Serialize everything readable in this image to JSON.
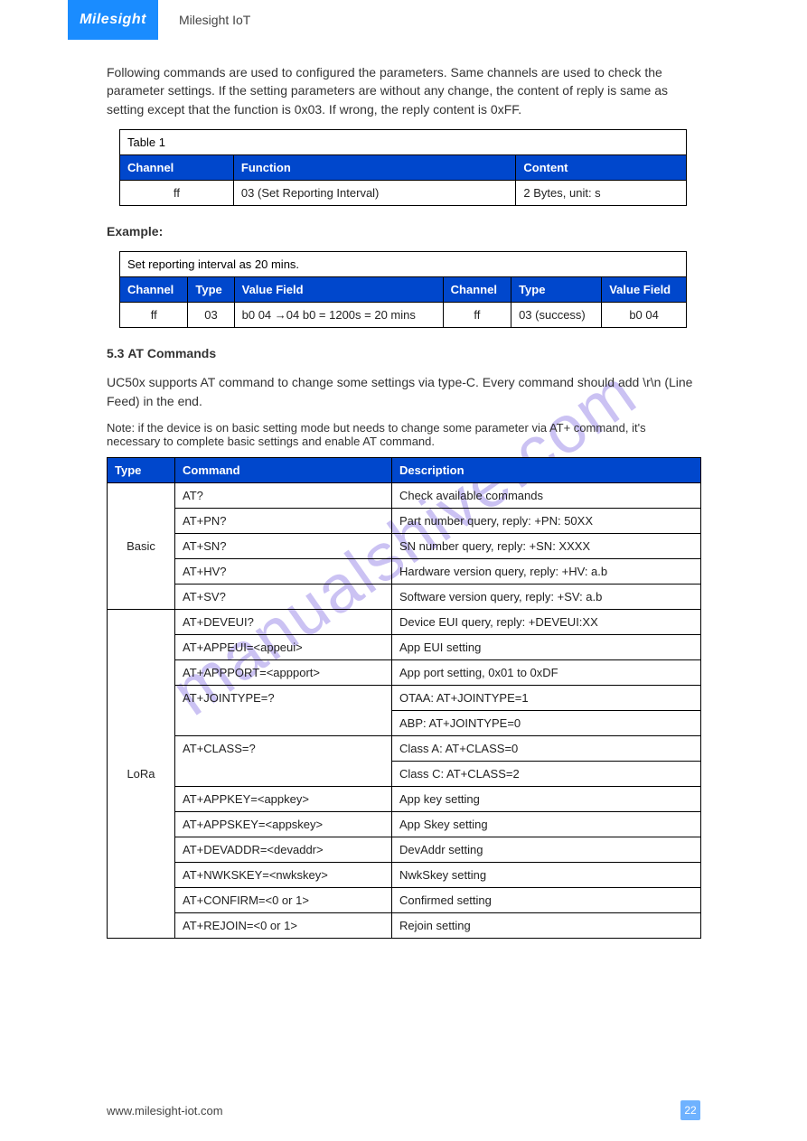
{
  "header": {
    "logo_text": "Milesight",
    "brand_sub": "Milesight IoT"
  },
  "watermark": "manualshive.com",
  "intro_para": "Following commands are used to configured the parameters. Same channels are used to check the parameter settings. If the setting parameters are without any change, the content of reply is same as setting except that the function is 0x03. If wrong, the reply content is 0xFF.",
  "table1": {
    "caption": "Table 1",
    "headers": [
      "Channel",
      "Function",
      "Content"
    ],
    "rows": [
      [
        "ff",
        "03 (Set Reporting Interval)",
        "2 Bytes, unit: s"
      ]
    ]
  },
  "example_heading": "Example:",
  "table2": {
    "caption": "Set reporting interval as 20 mins.",
    "headers": [
      "Channel",
      "Type",
      "Value Field",
      "Channel",
      "Type",
      "Value Field"
    ],
    "rows": [
      [
        "ff",
        "03",
        "b0 04 →04 b0 = 1200s = 20 mins",
        "ff",
        "03 (success)",
        "b0 04"
      ]
    ]
  },
  "section": {
    "number": "5.3",
    "title": "AT Commands"
  },
  "at_para": "UC50x supports AT command to change some settings via type-C. Every command should add \\r\\n (Line Feed) in the end.",
  "note": "Note: if the device is on basic setting mode but needs to change some parameter via AT+ command, it's necessary to complete basic settings and enable AT command.",
  "table3": {
    "headers": [
      "Type",
      "Command",
      "Description"
    ],
    "groups": [
      {
        "type": "Basic",
        "rows": [
          [
            "AT?",
            "Check available commands"
          ],
          [
            "AT+PN?",
            "Part number query, reply: +PN: 50XX"
          ],
          [
            "AT+SN?",
            "SN number query, reply: +SN: XXXX"
          ],
          [
            "AT+HV?",
            "Hardware version query, reply: +HV: a.b"
          ],
          [
            "AT+SV?",
            "Software version query, reply: +SV: a.b"
          ]
        ]
      },
      {
        "type": "LoRa",
        "rows": [
          [
            "AT+DEVEUI?",
            "Device EUI query, reply: +DEVEUI:XX"
          ],
          [
            "AT+APPEUI=<appeui>",
            "App EUI setting"
          ],
          [
            "AT+APPPORT=<appport>",
            "App port setting, 0x01 to 0xDF"
          ],
          [
            "AT+JOINTYPE=?",
            "OTAA: AT+JOINTYPE=1"
          ],
          [
            "",
            "ABP: AT+JOINTYPE=0"
          ],
          [
            "AT+CLASS=?",
            "Class A: AT+CLASS=0"
          ],
          [
            "",
            "Class C: AT+CLASS=2"
          ],
          [
            "AT+APPKEY=<appkey>",
            "App key setting"
          ],
          [
            "AT+APPSKEY=<appskey>",
            "App Skey setting"
          ],
          [
            "AT+DEVADDR=<devaddr>",
            "DevAddr setting"
          ],
          [
            "AT+NWKSKEY=<nwkskey>",
            "NwkSkey setting"
          ],
          [
            "AT+CONFIRM=<0 or 1>",
            "Confirmed setting"
          ],
          [
            "AT+REJOIN=<0 or 1>",
            "Rejoin setting"
          ]
        ]
      }
    ]
  },
  "footer": {
    "url": "www.milesight-iot.com",
    "page": "22"
  }
}
